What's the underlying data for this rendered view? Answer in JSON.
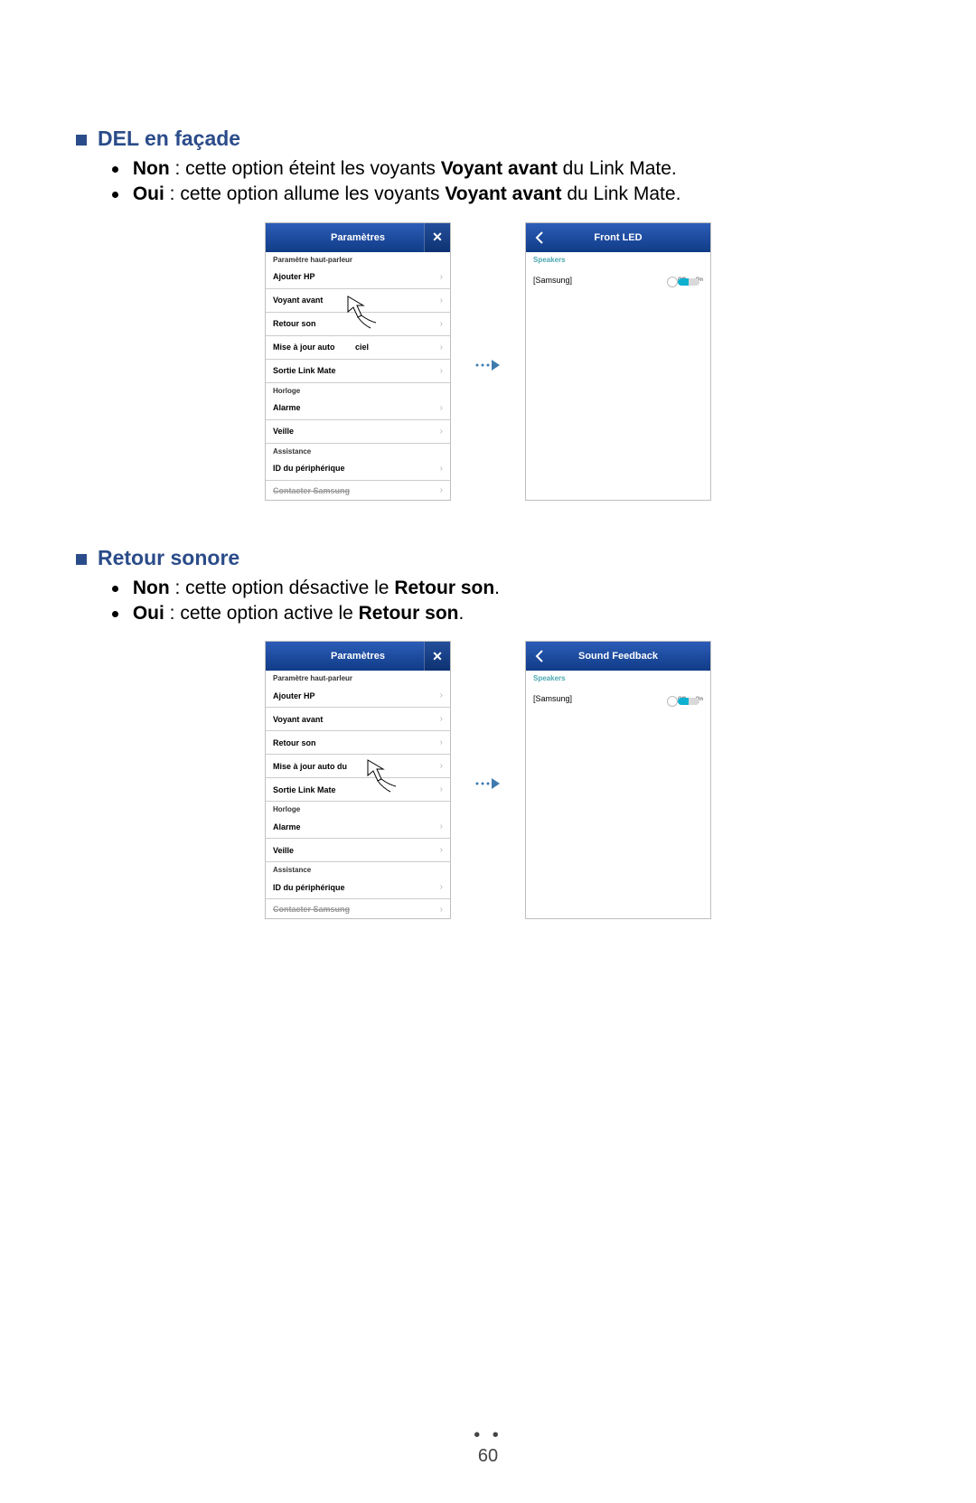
{
  "sections": [
    {
      "heading": "DEL en façade",
      "bullets": [
        {
          "lead": "Non",
          "mid": " : cette option éteint les voyants ",
          "bold2": "Voyant avant",
          "tail": " du Link Mate."
        },
        {
          "lead": "Oui",
          "mid": " : cette option allume les voyants ",
          "bold2": "Voyant avant",
          "tail": " du Link Mate."
        }
      ]
    },
    {
      "heading": "Retour sonore",
      "bullets": [
        {
          "lead": "Non",
          "mid": " : cette option désactive le ",
          "bold2": "Retour son",
          "tail": "."
        },
        {
          "lead": "Oui",
          "mid": " : cette option active le ",
          "bold2": "Retour son",
          "tail": "."
        }
      ]
    }
  ],
  "leftPanel": {
    "title": "Paramètres",
    "sectionA": "Paramètre haut-parleur",
    "rowsA": [
      "Ajouter HP"
    ],
    "rowVoyant1": "Voyant avant",
    "rowRetour1": "Retour son",
    "rowMaj1_before": "Mise à jour auto",
    "rowMaj1_after": "ciel",
    "rowMaj2": "Mise à jour auto du",
    "rowSortie": "Sortie Link Mate",
    "sectionB": "Horloge",
    "rowsB": [
      "Alarme",
      "Veille"
    ],
    "sectionC": "Assistance",
    "rowsC": [
      "ID du périphérique"
    ],
    "rowCut": "Contacter Samsung"
  },
  "rightPanel1": {
    "title": "Front LED",
    "section": "Speakers",
    "item": "[Samsung]",
    "off": "Off",
    "on": "On"
  },
  "rightPanel2": {
    "title": "Sound Feedback",
    "section": "Speakers",
    "item": "[Samsung]",
    "off": "Off",
    "on": "On"
  },
  "pageNumber": "60"
}
